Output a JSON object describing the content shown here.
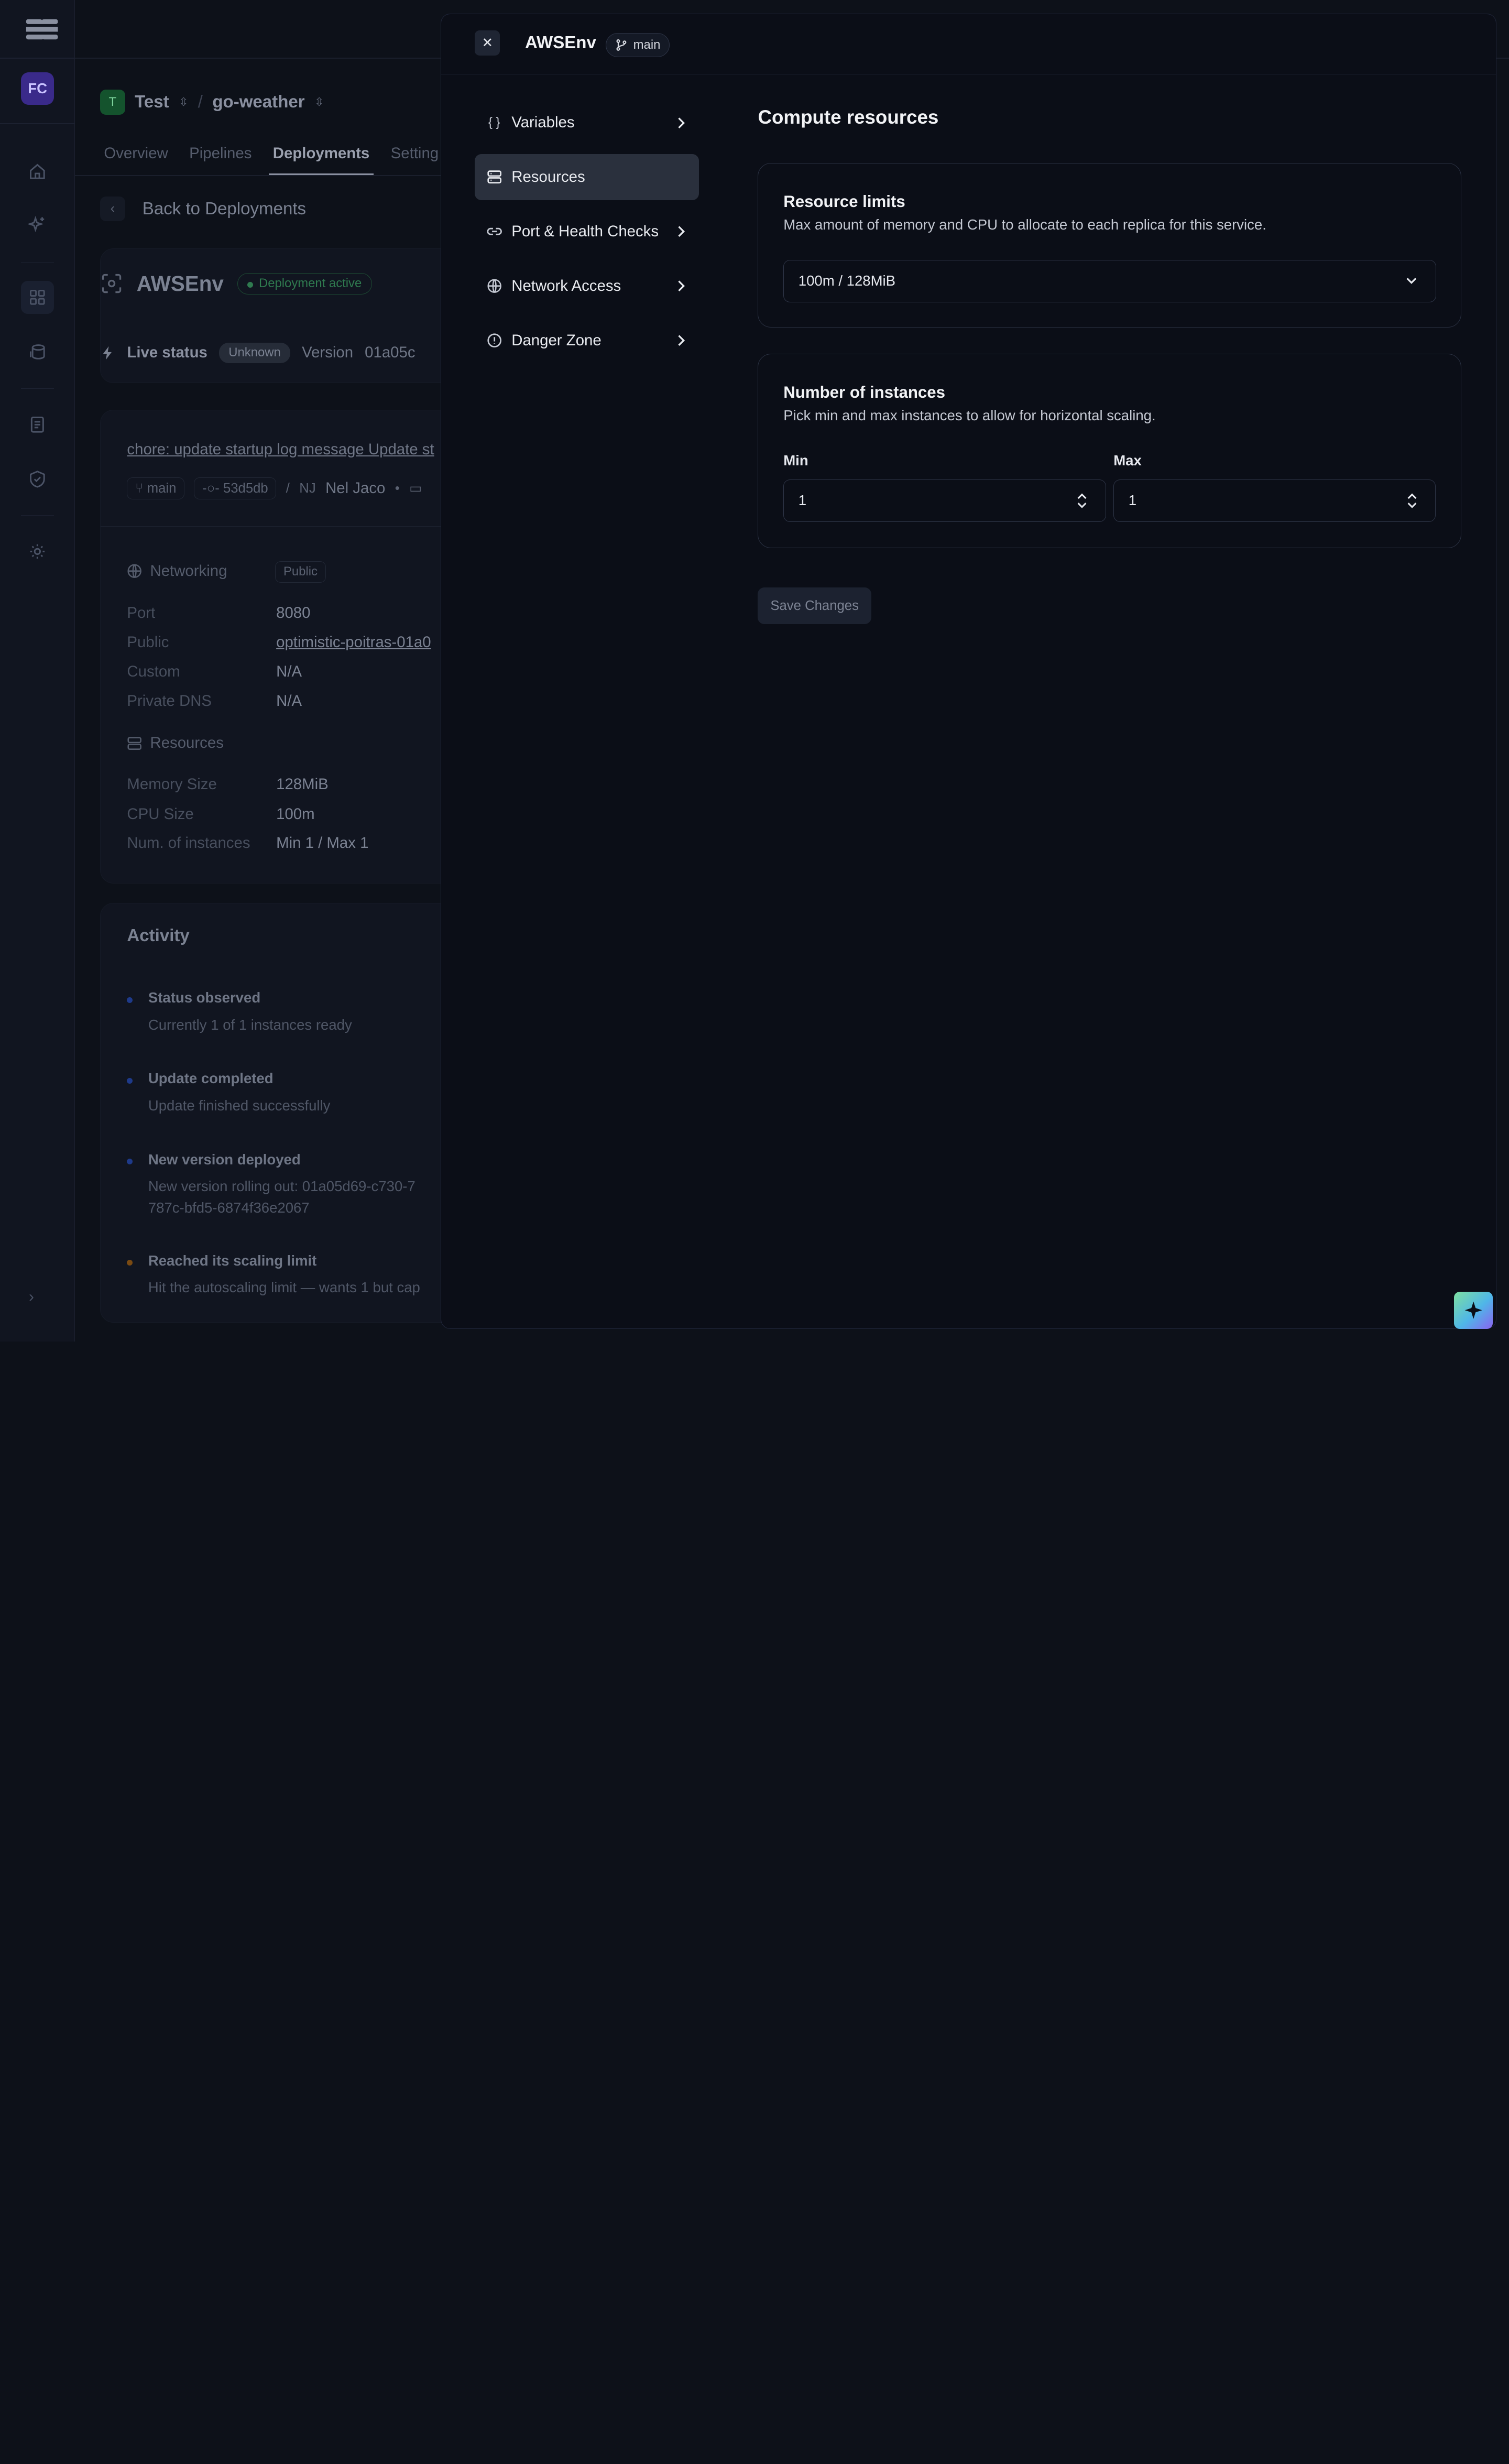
{
  "sidebar": {
    "avatar_initials": "FC"
  },
  "breadcrumb": {
    "team_initial": "T",
    "team": "Test",
    "project": "go-weather",
    "separator": "/"
  },
  "tabs": [
    "Overview",
    "Pipelines",
    "Deployments",
    "Setting"
  ],
  "back": {
    "label": "Back to Deployments"
  },
  "deployment": {
    "name": "AWSEnv",
    "status": "Deployment active",
    "live_label": "Live status",
    "live_value": "Unknown",
    "version_label": "Version",
    "version_value": "01a05c",
    "commit_message": "chore: update startup log message Update st",
    "branch": "main",
    "commit_hash": "53d5db",
    "author_initials": "NJ",
    "author": "Nel Jaco",
    "meta_sep": "/",
    "meta_dot": "•"
  },
  "networking": {
    "title": "Networking",
    "badge": "Public",
    "rows": [
      {
        "k": "Port",
        "v": "8080"
      },
      {
        "k": "Public",
        "v": "optimistic-poitras-01a0"
      },
      {
        "k": "Custom",
        "v": "N/A"
      },
      {
        "k": "Private DNS",
        "v": "N/A"
      }
    ]
  },
  "resources_summary": {
    "title": "Resources",
    "rows": [
      {
        "k": "Memory Size",
        "v": "128MiB"
      },
      {
        "k": "CPU Size",
        "v": "100m"
      },
      {
        "k": "Num. of instances",
        "v": "Min 1 / Max 1"
      }
    ]
  },
  "activity": {
    "title": "Activity",
    "items": [
      {
        "title": "Status observed",
        "desc": "Currently 1 of 1 instances ready"
      },
      {
        "title": "Update completed",
        "desc": "Update finished successfully"
      },
      {
        "title": "New version deployed",
        "desc": "New version rolling out: 01a05d69-c730-7",
        "desc2": "787c-bfd5-6874f36e2067"
      },
      {
        "title": "Reached its scaling limit",
        "desc": "Hit the autoscaling limit — wants 1 but cap"
      }
    ]
  },
  "drawer": {
    "title": "AWSEnv",
    "branch": "main",
    "menu": [
      {
        "label": "Variables",
        "icon": "braces-icon"
      },
      {
        "label": "Resources",
        "icon": "server-icon"
      },
      {
        "label": "Port & Health Checks",
        "icon": "link-icon"
      },
      {
        "label": "Network Access",
        "icon": "globe-icon"
      },
      {
        "label": "Danger Zone",
        "icon": "alert-circle-icon"
      }
    ],
    "heading": "Compute resources",
    "limits": {
      "title": "Resource limits",
      "desc": "Max amount of memory and CPU to allocate to each replica for this service.",
      "value": "100m / 128MiB"
    },
    "instances": {
      "title": "Number of instances",
      "desc": "Pick min and max instances to allow for horizontal scaling.",
      "min_label": "Min",
      "max_label": "Max",
      "min_value": "1",
      "max_value": "1"
    },
    "save_label": "Save Changes"
  }
}
